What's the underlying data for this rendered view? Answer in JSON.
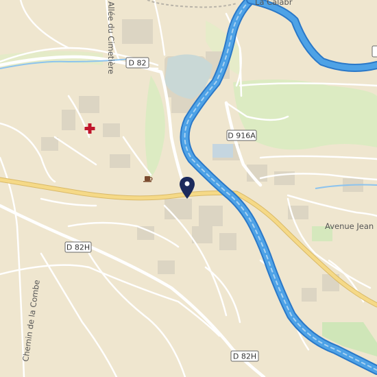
{
  "map": {
    "road_shields": {
      "d82_top": "D 82",
      "d916a": "D 916A",
      "d82h_left": "D 82H",
      "d82h_bottom": "D 82H"
    },
    "street_labels": {
      "cimetiere": "Allée du Cimetière",
      "avenue_jean": "Avenue Jean M",
      "chemin_combe": "Chemin de la Combe",
      "calabr": "La Calabr"
    },
    "pois": {
      "hospital": "hospital-icon",
      "cafe": "cafe-icon",
      "pin": "location-pin-icon"
    },
    "colors": {
      "land": "#efe6cf",
      "river": "#4ea2e6",
      "river_edge": "#2a78c8",
      "main_road": "#f5d987",
      "road": "#ffffff",
      "park": "#dcebc2",
      "building": "#d9d3c4",
      "pin": "#1c2a5c",
      "hospital": "#c0152c"
    }
  }
}
